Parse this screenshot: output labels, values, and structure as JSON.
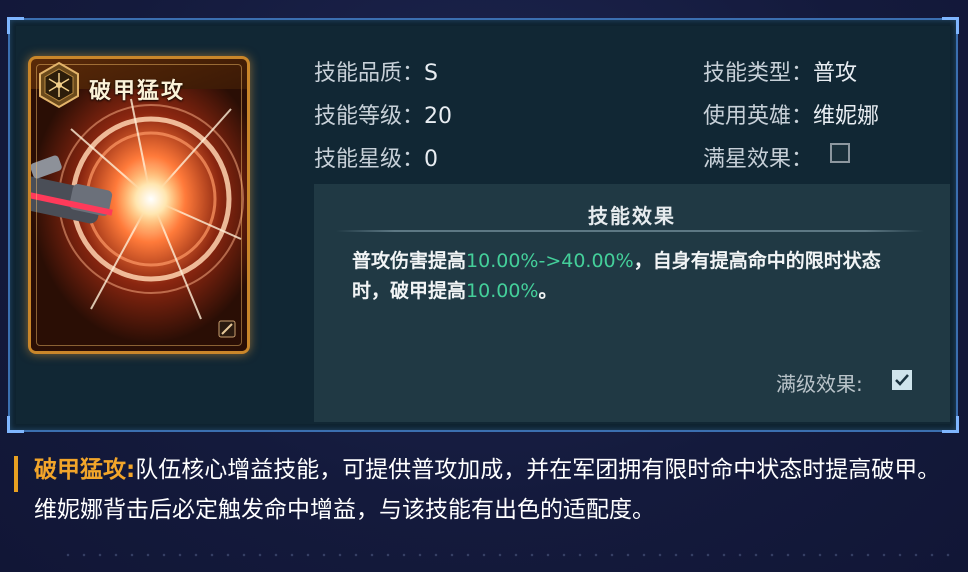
{
  "card": {
    "title": "破甲猛攻"
  },
  "stats": {
    "quality_label": "技能品质：",
    "quality_value": "S",
    "level_label": "技能等级：",
    "level_value": "20",
    "star_label": "技能星级：",
    "star_value": "0",
    "type_label": "技能类型：",
    "type_value": "普攻",
    "hero_label": "使用英雄：",
    "hero_value": "维妮娜",
    "fullstar_label": "满星效果：",
    "fullstar_checked": false
  },
  "effect": {
    "title": "技能效果",
    "text_part1": "普攻伤害提高",
    "highlight1": "10.00%->40.00%",
    "text_part2": "，自身有提高命中的限时状态时，破甲提高",
    "highlight2": "10.00%",
    "text_part3": "。",
    "maxlevel_label": "满级效果:",
    "maxlevel_checked": true
  },
  "description": {
    "name": "破甲猛攻:",
    "text": "队伍核心增益技能，可提供普攻加成，并在军团拥有限时命中状态时提高破甲。维妮娜背击后必定触发命中增益，与该技能有出色的适配度。"
  },
  "colors": {
    "highlight": "#44cf9a",
    "accent_gold": "#f2a52a",
    "frame_blue": "#3b6fb0"
  }
}
